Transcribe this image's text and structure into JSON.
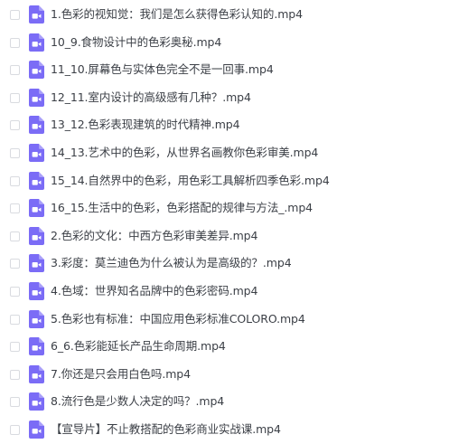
{
  "file_icon": "video-file-icon",
  "icon_color": "#7b6cf6",
  "files": [
    {
      "name": "1.色彩的视知觉：我们是怎么获得色彩认知的.mp4"
    },
    {
      "name": "10_9.食物设计中的色彩奥秘.mp4"
    },
    {
      "name": "11_10.屏幕色与实体色完全不是一回事.mp4"
    },
    {
      "name": "12_11.室内设计的高级感有几种？.mp4"
    },
    {
      "name": "13_12.色彩表现建筑的时代精神.mp4"
    },
    {
      "name": "14_13.艺术中的色彩，从世界名画教你色彩审美.mp4"
    },
    {
      "name": "15_14.自然界中的色彩，用色彩工具解析四季色彩.mp4"
    },
    {
      "name": "16_15.生活中的色彩，色彩搭配的规律与方法_.mp4"
    },
    {
      "name": "2.色彩的文化：中西方色彩审美差异.mp4"
    },
    {
      "name": "3.彩度：莫兰迪色为什么被认为是高级的？.mp4"
    },
    {
      "name": "4.色域：世界知名品牌中的色彩密码.mp4"
    },
    {
      "name": "5.色彩也有标准：中国应用色彩标准COLORO.mp4"
    },
    {
      "name": "6_6.色彩能延长产品生命周期.mp4"
    },
    {
      "name": "7.你还是只会用白色吗.mp4"
    },
    {
      "name": "8.流行色是少数人决定的吗？.mp4"
    },
    {
      "name": "【宣导片】不止教搭配的色彩商业实战课.mp4"
    }
  ]
}
